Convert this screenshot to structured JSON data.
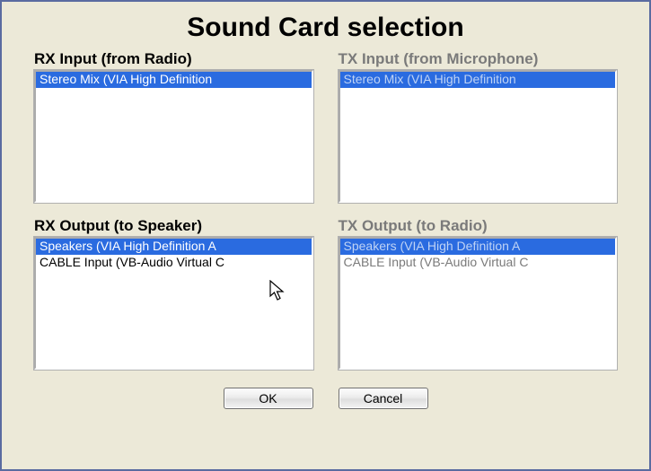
{
  "title": "Sound Card selection",
  "panels": {
    "rx_input": {
      "label": "RX Input (from Radio)",
      "items": [
        "Stereo Mix (VIA High Definition"
      ],
      "selected": 0,
      "enabled": true
    },
    "tx_input": {
      "label": "TX Input (from Microphone)",
      "items": [
        "Stereo Mix (VIA High Definition"
      ],
      "selected": 0,
      "enabled": false
    },
    "rx_output": {
      "label": "RX Output (to Speaker)",
      "items": [
        "Speakers (VIA High Definition A",
        "CABLE Input (VB-Audio Virtual C"
      ],
      "selected": 0,
      "enabled": true
    },
    "tx_output": {
      "label": "TX Output (to Radio)",
      "items": [
        "Speakers (VIA High Definition A",
        "CABLE Input (VB-Audio Virtual C"
      ],
      "selected": 0,
      "enabled": false
    }
  },
  "buttons": {
    "ok": "OK",
    "cancel": "Cancel"
  }
}
